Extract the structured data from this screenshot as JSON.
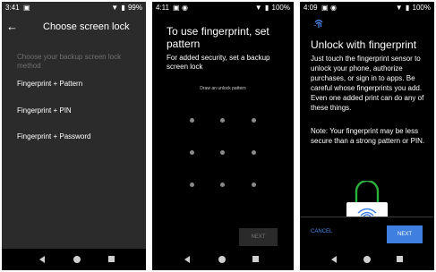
{
  "screens": [
    {
      "status": {
        "time": "3:41",
        "battery": "99%"
      },
      "title": "Choose screen lock",
      "subtitle": "Choose your backup screen lock method",
      "options": [
        "Fingerprint + Pattern",
        "Fingerprint + PIN",
        "Fingerprint + Password"
      ]
    },
    {
      "status": {
        "time": "4:11",
        "battery": "100%"
      },
      "heading": "To use fingerprint, set pattern",
      "description": "For added security, set a backup screen lock",
      "hint": "Draw an unlock pattern",
      "next_label": "NEXT"
    },
    {
      "status": {
        "time": "4:09",
        "battery": "100%"
      },
      "heading": "Unlock with fingerprint",
      "description": "Just touch the fingerprint sensor to unlock your phone, authorize purchases, or sign in to apps. Be careful whose fingerprints you add. Even one added print can do any of these things.",
      "note": "Note: Your fingerprint may be less secure than a strong pattern or PIN.",
      "cancel_label": "CANCEL",
      "next_label": "NEXT"
    }
  ],
  "colors": {
    "accent": "#3f7fe0",
    "lock_shackle": "#2bb03c",
    "panel1_bg": "#2b2b2b"
  },
  "icons": {
    "status": [
      "image-icon",
      "circle-icon",
      "wifi-icon",
      "battery-icon"
    ],
    "nav": [
      "back-icon",
      "home-icon",
      "recents-icon"
    ]
  }
}
